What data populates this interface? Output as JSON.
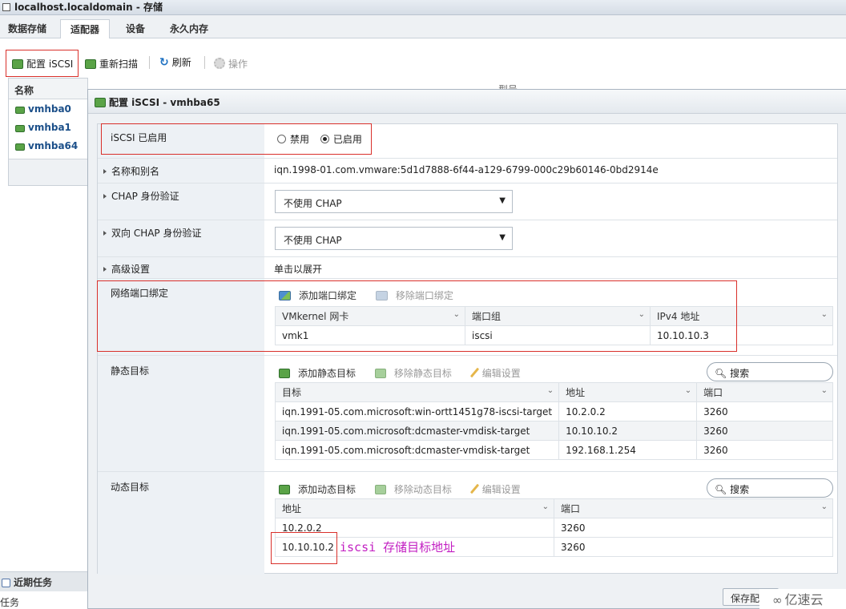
{
  "window": {
    "title": "localhost.localdomain - 存储"
  },
  "tabs": [
    {
      "label": "数据存储"
    },
    {
      "label": "适配器"
    },
    {
      "label": "设备"
    },
    {
      "label": "永久内存"
    }
  ],
  "toolbar": {
    "configure": "配置 iSCSI",
    "rescan": "重新扫描",
    "refresh": "刷新",
    "actions": "操作"
  },
  "left_list": {
    "header": "名称",
    "items": [
      "vmhba0",
      "vmhba1",
      "vmhba64"
    ]
  },
  "background_header": "型号",
  "recent_tasks": {
    "header": "近期任务",
    "sub": "任务"
  },
  "dialog": {
    "title": "配置 iSCSI - vmhba65",
    "iscsi_enabled": {
      "label": "iSCSI 已启用",
      "opt_disabled": "禁用",
      "opt_enabled": "已启用",
      "selected": "已启用"
    },
    "name_alias": {
      "label": "名称和别名",
      "value": "iqn.1998-01.com.vmware:5d1d7888-6f44-a129-6799-000c29b60146-0bd2914e"
    },
    "chap": {
      "label": "CHAP 身份验证",
      "value": "不使用 CHAP"
    },
    "mutual_chap": {
      "label": "双向 CHAP 身份验证",
      "value": "不使用 CHAP"
    },
    "advanced": {
      "label": "高级设置",
      "value": "单击以展开"
    },
    "port_binding": {
      "label": "网络端口绑定",
      "add": "添加端口绑定",
      "remove": "移除端口绑定",
      "columns": [
        "VMkernel 网卡",
        "端口组",
        "IPv4 地址"
      ],
      "rows": [
        [
          "vmk1",
          "iscsi",
          "10.10.10.3"
        ]
      ]
    },
    "static_targets": {
      "label": "静态目标",
      "add": "添加静态目标",
      "remove": "移除静态目标",
      "edit": "编辑设置",
      "search": "搜索",
      "columns": [
        "目标",
        "地址",
        "端口"
      ],
      "rows": [
        [
          "iqn.1991-05.com.microsoft:win-ortt1451g78-iscsi-target",
          "10.2.0.2",
          "3260"
        ],
        [
          "iqn.1991-05.com.microsoft:dcmaster-vmdisk-target",
          "10.10.10.2",
          "3260"
        ],
        [
          "iqn.1991-05.com.microsoft:dcmaster-vmdisk-target",
          "192.168.1.254",
          "3260"
        ]
      ]
    },
    "dynamic_targets": {
      "label": "动态目标",
      "add": "添加动态目标",
      "remove": "移除动态目标",
      "edit": "编辑设置",
      "search": "搜索",
      "columns": [
        "地址",
        "端口"
      ],
      "rows": [
        [
          "10.2.0.2",
          "3260"
        ],
        [
          "10.10.10.2",
          "3260"
        ]
      ]
    },
    "save_button": "保存配"
  },
  "annotation": "iscsi 存储目标地址",
  "watermark": "亿速云",
  "colors": {
    "highlight_box": "#d9302b",
    "annotation": "#c21fc2",
    "link": "#1b4f89"
  }
}
